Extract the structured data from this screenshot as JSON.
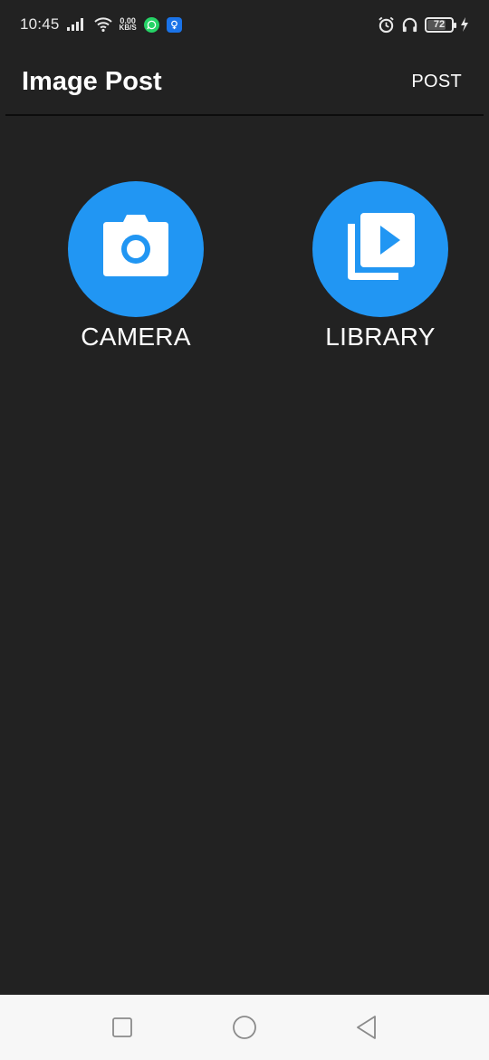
{
  "status_bar": {
    "time": "10:45",
    "net_speed_value": "0.00",
    "net_speed_unit": "KB/S",
    "battery_level": "72",
    "icons": [
      "signal-icon",
      "wifi-icon",
      "whatsapp-icon",
      "app-notification-icon",
      "alarm-icon",
      "headphones-icon",
      "battery-icon",
      "charging-icon"
    ]
  },
  "app_bar": {
    "title": "Image Post",
    "action_label": "POST"
  },
  "options": {
    "camera": {
      "label": "CAMERA",
      "icon": "camera-icon"
    },
    "library": {
      "label": "LIBRARY",
      "icon": "video-library-icon"
    }
  },
  "colors": {
    "background": "#222222",
    "accent": "#2196f3",
    "text": "#ffffff",
    "nav_bar": "#f7f7f7"
  },
  "nav_bar": {
    "icons": [
      "recents-icon",
      "home-icon",
      "back-icon"
    ]
  }
}
